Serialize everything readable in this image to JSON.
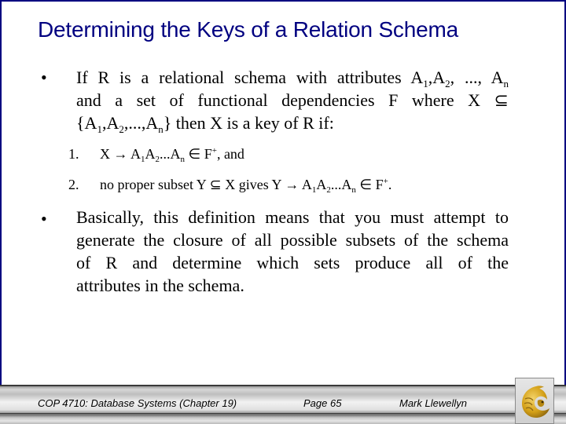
{
  "slide": {
    "title": "Determining the Keys of a Relation Schema",
    "bullet_glyph": "•",
    "bullet1": {
      "line1_pre": "If R is a relational schema with attributes A",
      "line1_s1": "1",
      "line1_mid1": ",A",
      "line1_s2": "2",
      "line1_mid2": ", ..., A",
      "line1_sn": "n",
      "line2": "and a set of functional dependencies F where X ⊆",
      "line3_pre": "{A",
      "line3_s1": "1",
      "line3_mid1": ",A",
      "line3_s2": "2",
      "line3_mid2": ",...,A",
      "line3_sn": "n",
      "line3_post": "} then X is a key of R if:"
    },
    "conditions": [
      {
        "number": "1.",
        "pre": "X → A",
        "s1": "1",
        "mid1": "A",
        "s2": "2",
        "mid2": "...A",
        "sn": "n",
        "post1": " ∈ F",
        "sup": "+",
        "post2": ", and"
      },
      {
        "number": "2.",
        "pre": "no proper subset Y ⊆ X gives Y → A",
        "s1": "1",
        "mid1": "A",
        "s2": "2",
        "mid2": "...A",
        "sn": "n",
        "post1": " ∈ F",
        "sup": "+",
        "post2": "."
      }
    ],
    "bullet2": {
      "lines": [
        "Basically, this definition means that you must attempt to",
        "generate the closure of all possible subsets of the schema",
        "of R and determine which sets produce all of the",
        "attributes in the schema."
      ]
    }
  },
  "footer": {
    "course": "COP 4710: Database Systems  (Chapter 19)",
    "page": "Page 65",
    "author": "Mark Llewellyn",
    "logo_icon": "pegasus-logo-icon"
  },
  "colors": {
    "title": "#000080",
    "border": "#000080",
    "logo_gold": "#d4a017"
  }
}
